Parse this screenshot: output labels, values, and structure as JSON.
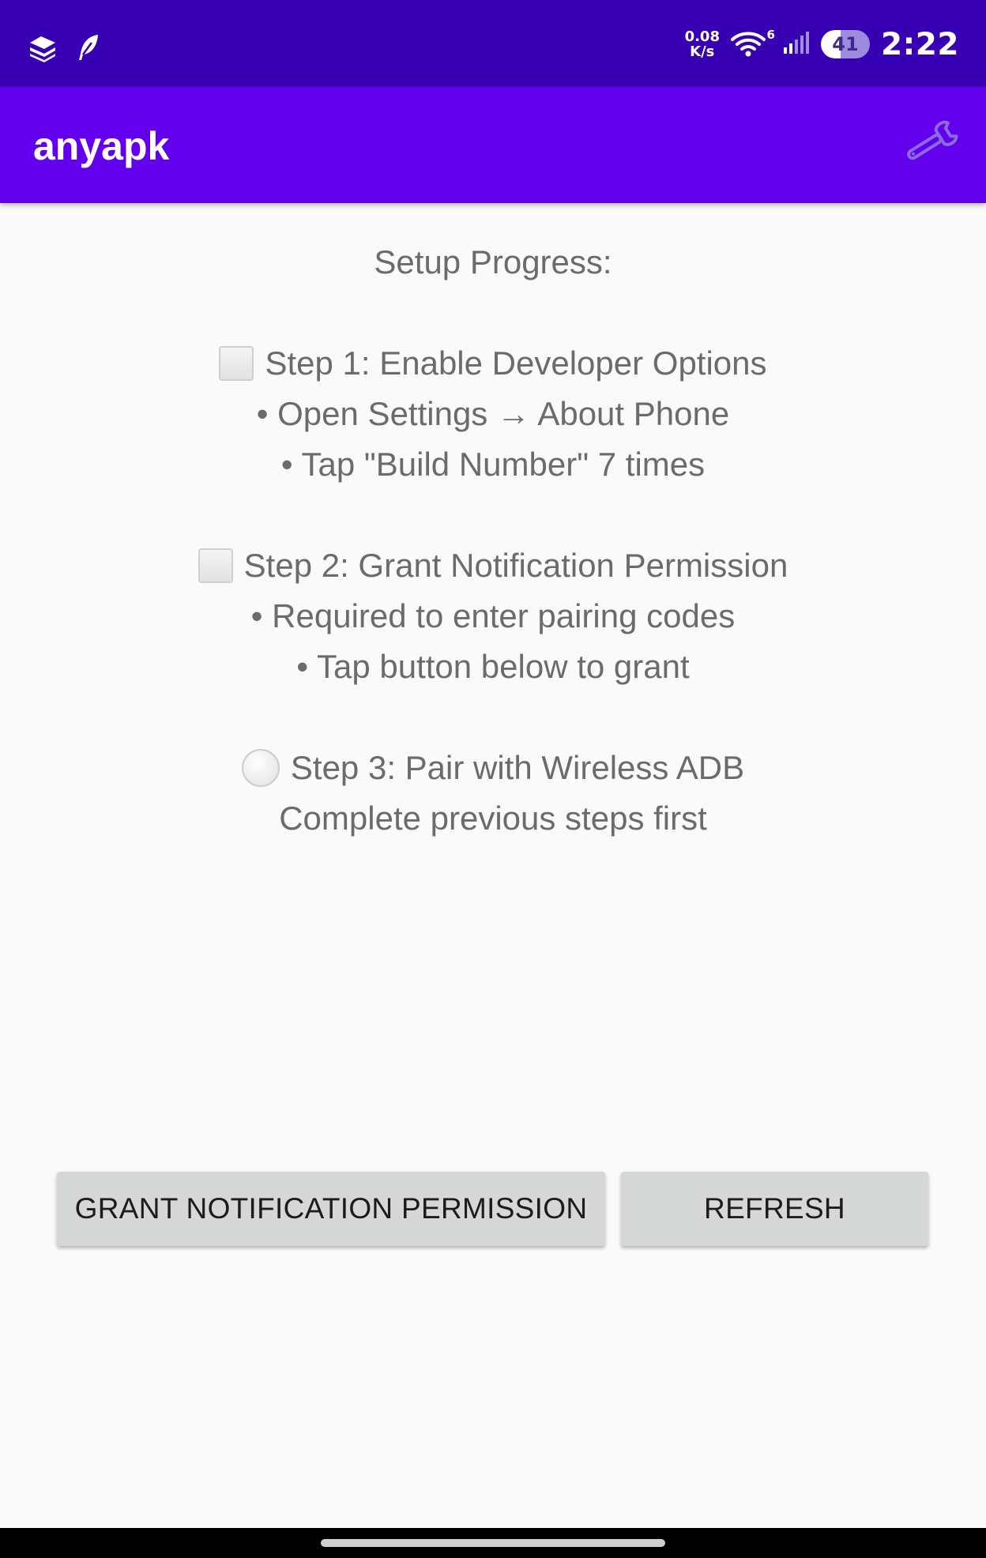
{
  "status_bar": {
    "net_speed_value": "0.08",
    "net_speed_unit": "K/s",
    "wifi_badge": "6",
    "battery_level": "41",
    "battery_fraction": 0.41,
    "time": "2:22",
    "icons": [
      "stack-icon",
      "feather-icon",
      "wifi-icon",
      "signal-icon",
      "battery-icon"
    ]
  },
  "app_bar": {
    "title": "anyapk",
    "action_icon": "wrench-icon"
  },
  "progress": {
    "header": "Setup Progress:",
    "steps": [
      {
        "status_icon": "checkbox-empty-icon",
        "title": "Step 1: Enable Developer Options",
        "details": [
          "• Open Settings → About Phone",
          "• Tap \"Build Number\" 7 times"
        ]
      },
      {
        "status_icon": "checkbox-empty-icon",
        "title": "Step 2: Grant Notification Permission",
        "details": [
          "• Required to enter pairing codes",
          "• Tap button below to grant"
        ]
      },
      {
        "status_icon": "circle-empty-icon",
        "title": "Step 3: Pair with Wireless ADB",
        "details": [
          "Complete previous steps first"
        ]
      }
    ]
  },
  "buttons": {
    "grant_label": "GRANT NOTIFICATION PERMISSION",
    "refresh_label": "REFRESH"
  },
  "colors": {
    "status_bar": "#3700b3",
    "app_bar": "#6200ee",
    "background": "#fafafa",
    "button": "#d6d7d7",
    "text_secondary": "#6b6b6b",
    "wrench": "#8b6be0"
  }
}
